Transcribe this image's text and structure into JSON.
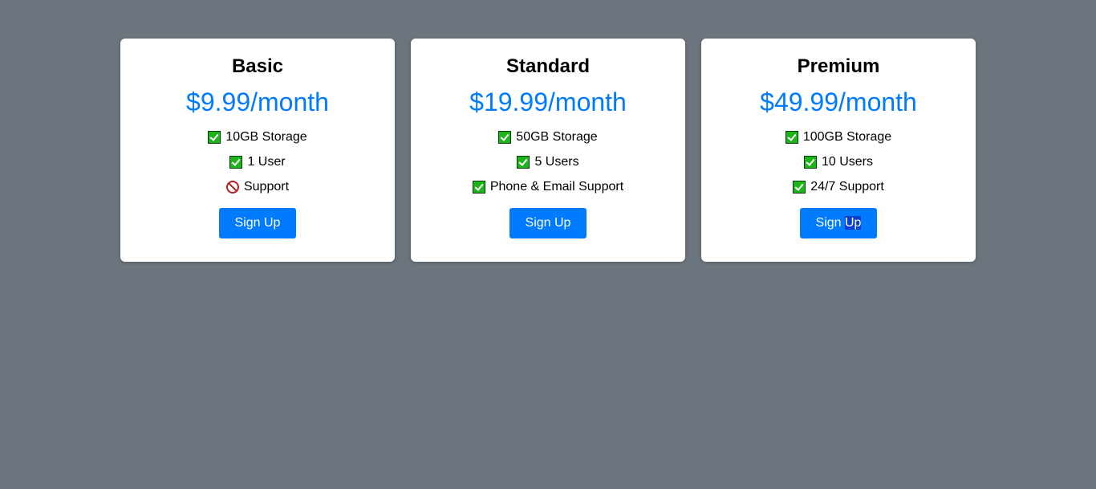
{
  "plans": [
    {
      "name": "Basic",
      "price": "$9.99/month",
      "features": [
        {
          "text": "10GB Storage",
          "icon": "check-icon"
        },
        {
          "text": "1 User",
          "icon": "check-icon"
        },
        {
          "text": "Support",
          "icon": "prohibited-icon"
        }
      ],
      "button": "Sign Up"
    },
    {
      "name": "Standard",
      "price": "$19.99/month",
      "features": [
        {
          "text": "50GB Storage",
          "icon": "check-icon"
        },
        {
          "text": "5 Users",
          "icon": "check-icon"
        },
        {
          "text": "Phone & Email Support",
          "icon": "check-icon"
        }
      ],
      "button": "Sign Up"
    },
    {
      "name": "Premium",
      "price": "$49.99/month",
      "features": [
        {
          "text": "100GB Storage",
          "icon": "check-icon"
        },
        {
          "text": "10 Users",
          "icon": "check-icon"
        },
        {
          "text": "24/7 Support",
          "icon": "check-icon"
        }
      ],
      "button_prefix": "Sign ",
      "button_selected": "Up"
    }
  ],
  "colors": {
    "background": "#6c757d",
    "accent": "#007bff",
    "check": "#1cb51c",
    "prohibited": "#b22222",
    "selection": "#0a3fcf"
  }
}
